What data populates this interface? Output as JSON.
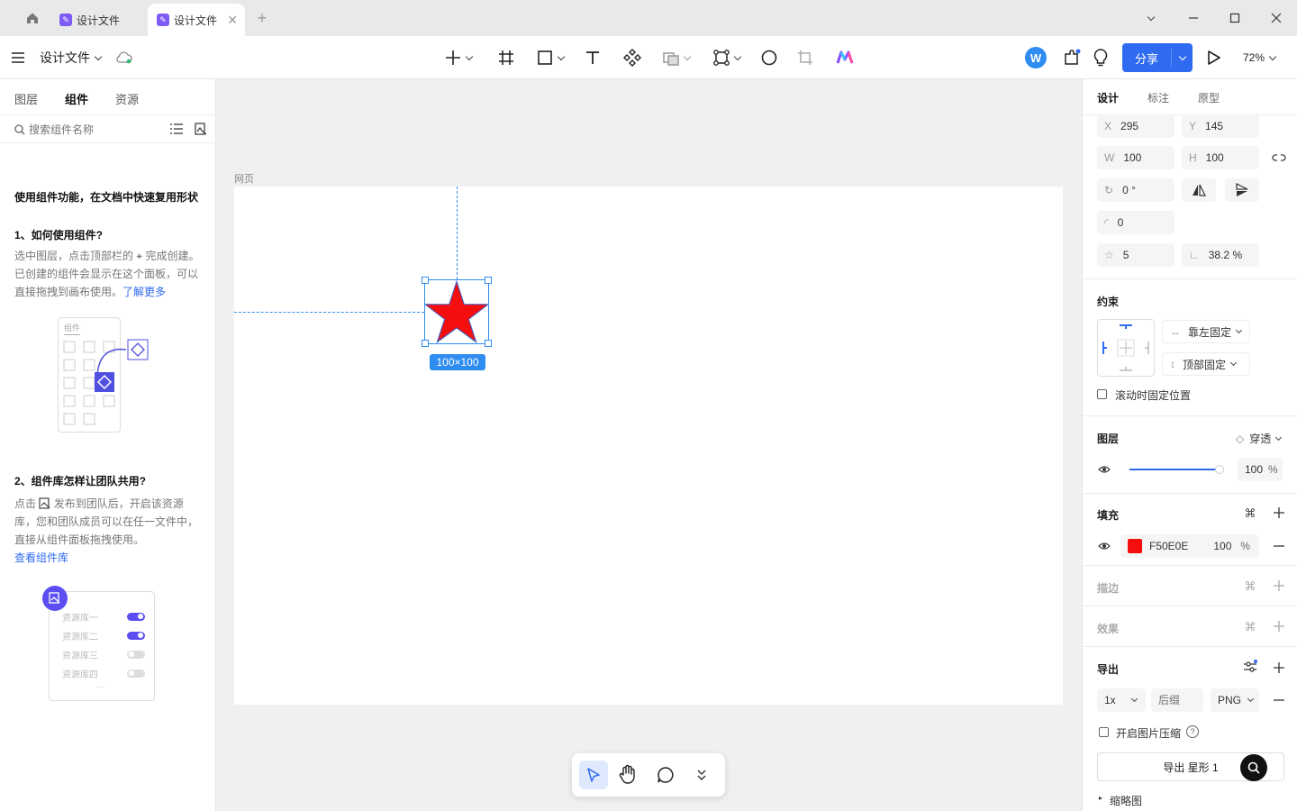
{
  "tabs": [
    {
      "label": "设计文件"
    },
    {
      "label": "设计文件"
    }
  ],
  "toolbar": {
    "file_title": "设计文件",
    "share_label": "分享",
    "zoom": "72%",
    "avatar_letter": "W"
  },
  "left_panel": {
    "tabs": [
      "图层",
      "组件",
      "资源"
    ],
    "search_placeholder": "搜索组件名称",
    "intro_title": "使用组件功能，在文档中快速复用形状",
    "q1_title": "1、如何使用组件?",
    "q1_text_a": "选中图层，点击顶部栏的",
    "q1_text_b": "完成创建。已创建的组件会显示在这个面板，可以直接拖拽到画布使用。",
    "q1_link": "了解更多",
    "illus1_label": "组件",
    "q2_title": "2、组件库怎样让团队共用?",
    "q2_text_a": "点击",
    "q2_text_b": "发布到团队后，开启该资源库，您和团队成员可以在任一文件中，直接从组件面板拖拽使用。",
    "q2_link": "查看组件库",
    "libraries": [
      {
        "name": "资源库一",
        "on": true
      },
      {
        "name": "资源库二",
        "on": true
      },
      {
        "name": "资源库三",
        "on": false
      },
      {
        "name": "资源库四",
        "on": false
      }
    ]
  },
  "canvas": {
    "frame_label": "网页",
    "selection_size": "100×100",
    "star_color": "#F50E0E"
  },
  "right_panel": {
    "tabs": [
      "设计",
      "标注",
      "原型"
    ],
    "x_label": "X",
    "x": "295",
    "y_label": "Y",
    "y": "145",
    "w_label": "W",
    "w": "100",
    "h_label": "H",
    "h": "100",
    "rotation": "0 °",
    "radius": "0",
    "points": "5",
    "ratio": "38.2 %",
    "constraints_title": "约束",
    "constraint_h": "靠左固定",
    "constraint_v": "顶部固定",
    "scroll_fixed": "滚动时固定位置",
    "layer_title": "图层",
    "blend_mode": "穿透",
    "opacity": "100",
    "opacity_value": 1.0,
    "pct": "%",
    "fill_title": "填充",
    "fill_hex": "F50E0E",
    "fill_opacity": "100",
    "stroke_title": "描边",
    "effect_title": "效果",
    "export_title": "导出",
    "export_scale": "1x",
    "export_suffix_placeholder": "后缀",
    "export_format": "PNG",
    "compress_label": "开启图片压缩",
    "export_button": "导出 星形 1",
    "thumbnail_label": "缩略图"
  }
}
